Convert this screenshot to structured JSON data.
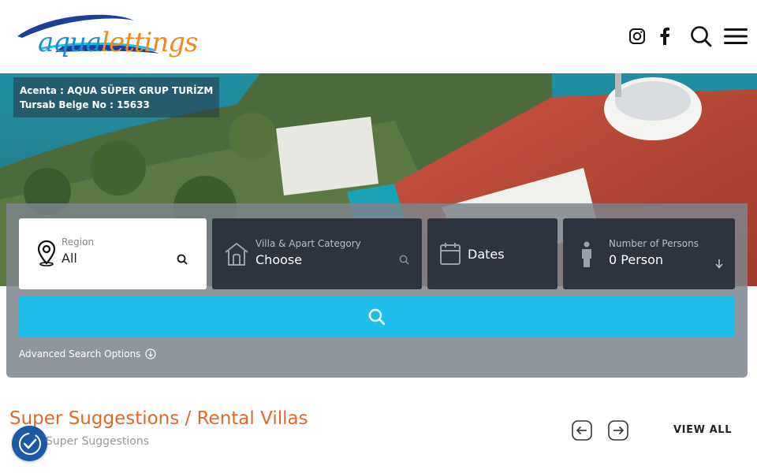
{
  "header": {
    "logo_text_1": "aqua",
    "logo_text_2": "lettings",
    "icons": [
      "instagram-icon",
      "facebook-icon",
      "search-icon",
      "menu-icon"
    ]
  },
  "hero": {
    "acenta_line1": "Acenta : AQUA SÜPER GRUP TURİZM",
    "acenta_line2": "Tursab Belge No : 15633"
  },
  "search": {
    "region": {
      "label": "Region",
      "value": "All"
    },
    "category": {
      "label": "Villa & Apart Category",
      "value": "Choose"
    },
    "dates": {
      "value": "Dates"
    },
    "persons": {
      "label": "Number of Persons",
      "value": "0 Person"
    },
    "advanced_label": "Advanced Search Options"
  },
  "suggestions": {
    "title": "Super Suggestions / Rental Villas",
    "subtitle": "Super Suggestions",
    "view_all": "VIEW ALL"
  },
  "colors": {
    "accent_blue": "#1fbdea",
    "title_orange": "#e0682a",
    "field_dark": "#2d3440"
  }
}
